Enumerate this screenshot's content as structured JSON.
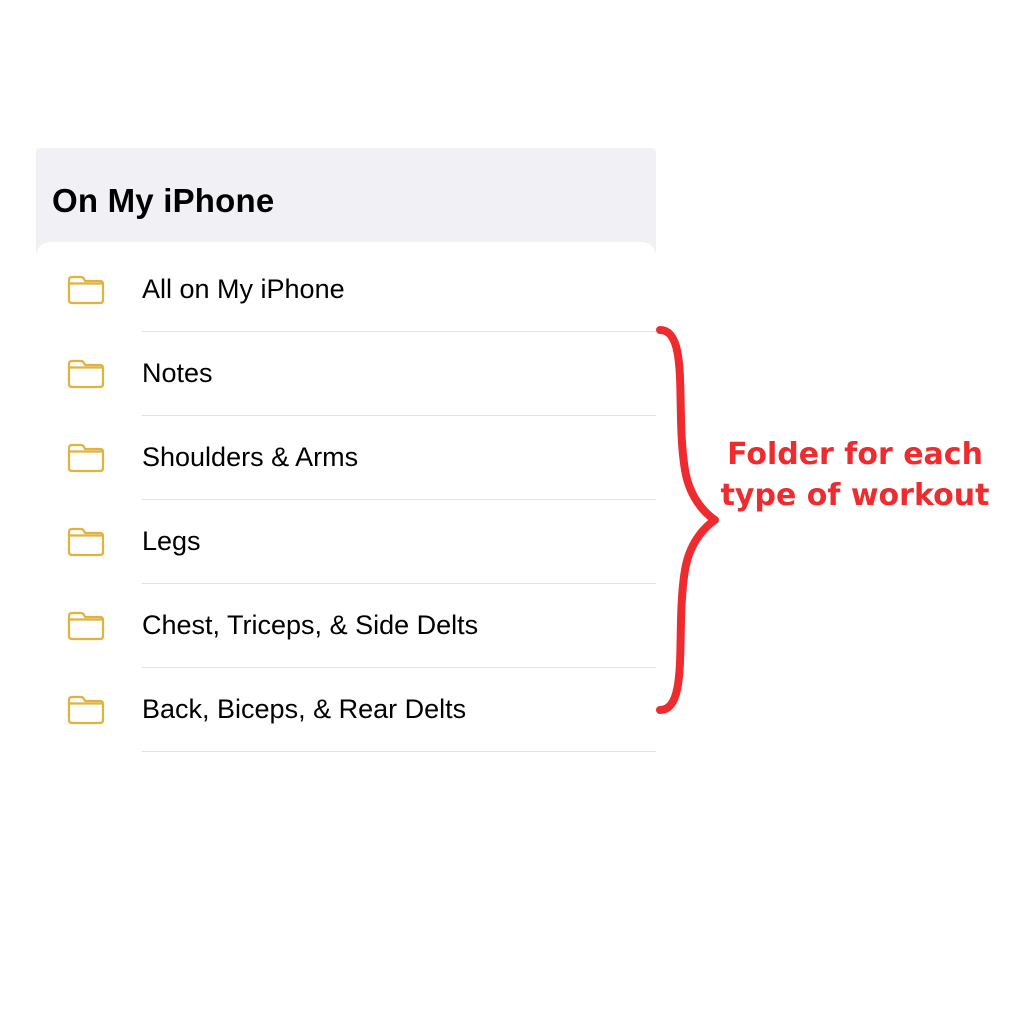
{
  "section": {
    "title": "On My iPhone"
  },
  "folders": [
    {
      "label": "All on My iPhone"
    },
    {
      "label": "Notes"
    },
    {
      "label": "Shoulders & Arms"
    },
    {
      "label": "Legs"
    },
    {
      "label": "Chest, Triceps, & Side Delts"
    },
    {
      "label": "Back, Biceps, & Rear Delts"
    }
  ],
  "annotation": {
    "text": "Folder for each type of workout"
  },
  "colors": {
    "accent": "#e1b23d",
    "annotation": "#ee2b2e"
  }
}
